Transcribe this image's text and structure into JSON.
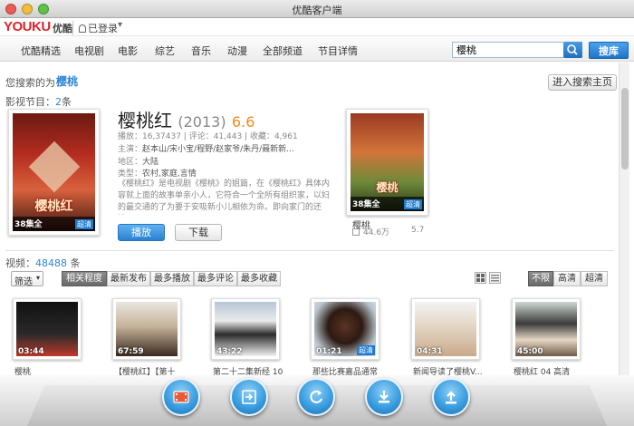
{
  "window": {
    "title": "优酷客户端",
    "traffic_colors": [
      "#ec5b55",
      "#f3bd3a",
      "#5ec148"
    ]
  },
  "header": {
    "logo": "YOUKU",
    "logo_cn": "优酷",
    "login": "已登录",
    "dropdown": "▾"
  },
  "nav": {
    "items": [
      "优酷精选",
      "电视剧",
      "电影",
      "综艺",
      "音乐",
      "动漫",
      "全部频道",
      "节目详情"
    ],
    "search_value": "樱桃",
    "search_button": "搜库"
  },
  "results": {
    "label": "您搜索的为：",
    "term": "樱桃",
    "enter_button": "进入搜索主页",
    "program_count_label": "影视节目：",
    "program_count": "2",
    "program_count_unit": "条"
  },
  "featured": {
    "poster_title": "樱桃红",
    "poster_episodes": "38集全",
    "poster_badge": "超清",
    "title": "樱桃红",
    "year": "(2013)",
    "score": "6.6",
    "stats": "播放：16,37437  |  评论：41,443  |  收藏：4,961",
    "cast_label": "主演：",
    "cast": "赵本山/宋小宝/程野/赵家爷/朱丹/聂新新...",
    "region_label": "地区：",
    "region": "大陆",
    "genre_label": "类型：",
    "genre": "农村,家庭,言情",
    "description": "《樱桃红》是电视剧《樱桃》的姐篇，在《樱桃红》具体内容就上面的故事单亲小人，它符合一个全所有组织家，以妇的最交通的了为要于安吸新小儿相依为命。即向家门的还被...",
    "play_button": "播放",
    "download_button": "下载"
  },
  "side_result": {
    "poster_title": "樱桃",
    "poster_episodes": "38集全",
    "poster_badge": "超清",
    "title": "樱桃",
    "views": "44.6万",
    "score": "5.7"
  },
  "videos": {
    "count_label": "视频：",
    "count": "48488",
    "count_unit": "条",
    "filter_select": "筛选",
    "sort_tabs": [
      "相关程度",
      "最新发布",
      "最多播放",
      "最多评论",
      "最多收藏"
    ],
    "quality_tabs": [
      "不限",
      "高清",
      "超清"
    ],
    "items": [
      {
        "duration": "03:44",
        "caption": "樱桃",
        "badge": ""
      },
      {
        "duration": "67:59",
        "caption": "【樱桃红】【第十",
        "badge": ""
      },
      {
        "duration": "43:22",
        "caption": "第二十二集新经 10",
        "badge": ""
      },
      {
        "duration": "01:21",
        "caption": "那些比赛嘉品通常",
        "badge": "超清"
      },
      {
        "duration": "04:31",
        "caption": "新闻导读了樱桃V...",
        "badge": ""
      },
      {
        "duration": "45:00",
        "caption": "樱桃红 04 高清",
        "badge": ""
      }
    ]
  },
  "dock": {
    "icons": [
      "film-icon",
      "export-icon",
      "refresh-icon",
      "download-icon",
      "upload-icon"
    ]
  }
}
